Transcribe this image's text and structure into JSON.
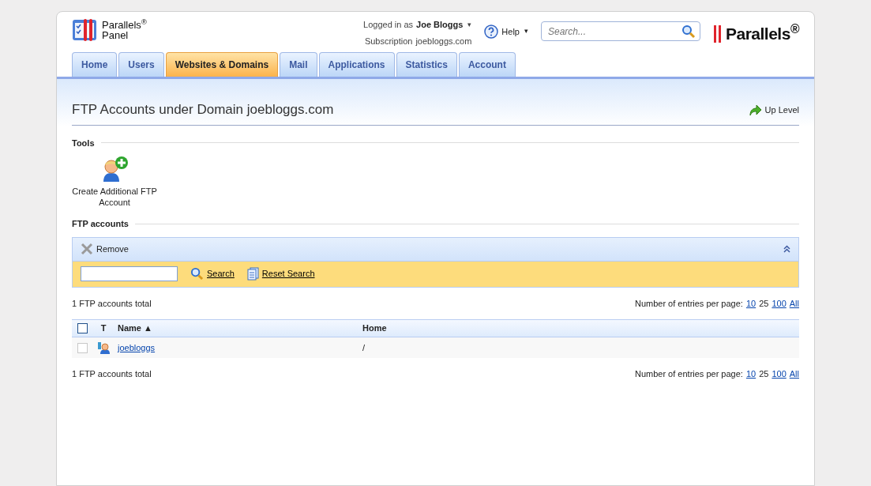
{
  "header": {
    "logo_text": "Parallels",
    "logo_sub": "Panel",
    "logo_mark": "®",
    "login_label": "Logged in as",
    "user": "Joe Bloggs",
    "subscription_label": "Subscription",
    "subscription": "joebloggs.com",
    "help": "Help",
    "caret": "▾",
    "search_placeholder": "Search...",
    "brand": "Parallels",
    "brand_mark": "®"
  },
  "tabs": [
    {
      "label": "Home",
      "selected": false
    },
    {
      "label": "Users",
      "selected": false
    },
    {
      "label": "Websites & Domains",
      "selected": true
    },
    {
      "label": "Mail",
      "selected": false
    },
    {
      "label": "Applications",
      "selected": false
    },
    {
      "label": "Statistics",
      "selected": false
    },
    {
      "label": "Account",
      "selected": false
    }
  ],
  "page_title": "FTP Accounts under Domain joebloggs.com",
  "up_level": "Up Level",
  "tools": {
    "heading": "Tools",
    "items": [
      {
        "label": "Create Additional FTP Account"
      }
    ]
  },
  "accounts": {
    "heading": "FTP accounts",
    "remove": "Remove",
    "search_button": "Search",
    "reset_button": "Reset Search",
    "total_top": "1 FTP accounts total",
    "total_bottom": "1 FTP accounts total",
    "per_page_label_top": "Number of entries per page:",
    "per_page_label_bottom": "Number of entries per page:",
    "select_all_checked": false,
    "per_page_top": [
      {
        "label": "10",
        "selected": false
      },
      {
        "label": "25",
        "selected": true
      },
      {
        "label": "100",
        "selected": false
      },
      {
        "label": "All",
        "selected": false
      }
    ],
    "per_page_bottom": [
      {
        "label": "10",
        "selected": false
      },
      {
        "label": "25",
        "selected": true
      },
      {
        "label": "100",
        "selected": false
      },
      {
        "label": "All",
        "selected": false
      }
    ],
    "columns": [
      "T",
      "Name",
      "Home"
    ],
    "sort_mark": "▲",
    "rows": [
      {
        "name": "joebloggs",
        "home": "/",
        "checked": false
      }
    ]
  }
}
